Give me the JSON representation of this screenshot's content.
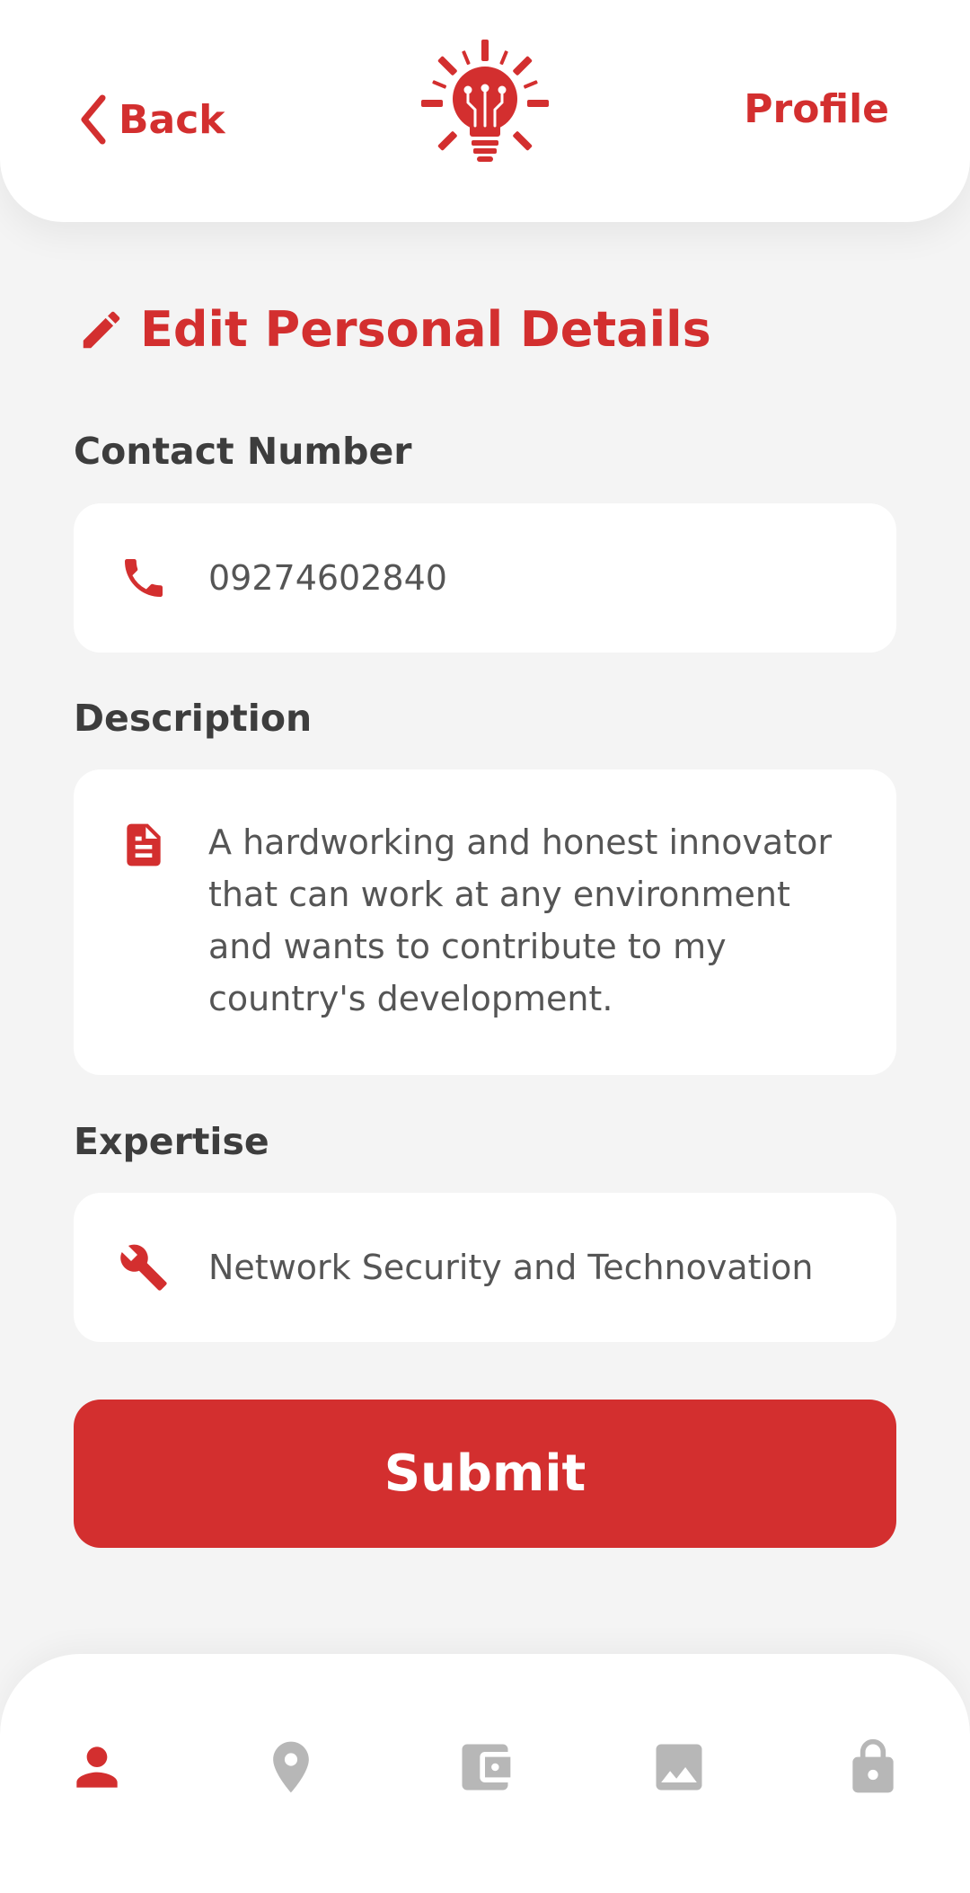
{
  "header": {
    "back_label": "Back",
    "profile_label": "Profile",
    "logo_icon": "lightbulb-sun-logo"
  },
  "page": {
    "title": "Edit Personal Details",
    "title_icon": "pencil-icon"
  },
  "form": {
    "contact": {
      "label": "Contact Number",
      "value": "09274602840",
      "icon": "phone-icon"
    },
    "description": {
      "label": "Description",
      "lines": [
        "A hardworking and honest innovator",
        "that can work at any environment",
        "and wants to contribute to my",
        "country's development."
      ],
      "icon": "document-icon"
    },
    "expertise": {
      "label": "Expertise",
      "value": "Network Security and Technovation",
      "icon": "wrench-icon"
    },
    "submit_label": "Submit"
  },
  "bottom_nav": {
    "items": [
      {
        "icon": "person-icon",
        "active": true
      },
      {
        "icon": "location-pin-icon",
        "active": false
      },
      {
        "icon": "wallet-icon",
        "active": false
      },
      {
        "icon": "image-icon",
        "active": false
      },
      {
        "icon": "lock-icon",
        "active": false
      }
    ]
  },
  "colors": {
    "accent": "#d32f2f",
    "background": "#f4f4f4",
    "surface": "#ffffff",
    "text": "#3d3d3d",
    "muted_icon": "#b7b7b7"
  }
}
